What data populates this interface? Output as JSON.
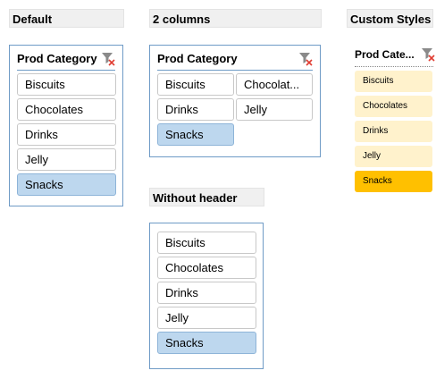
{
  "sections": {
    "default": "Default",
    "two_columns": "2 columns",
    "custom_styles": "Custom Styles",
    "without_header": "Without header"
  },
  "slicer_title": "Prod Category",
  "slicer_title_truncated": "Prod Cate...",
  "chocolates_truncated": "Chocolat...",
  "items": [
    "Biscuits",
    "Chocolates",
    "Drinks",
    "Jelly",
    "Snacks"
  ],
  "selected_item": "Snacks",
  "icons": {
    "clear_filter": "clear-filter-icon"
  },
  "colors": {
    "slicer_border": "#6f9bc6",
    "selected_fill": "#bdd7ee",
    "custom_item_fill": "#fff2cc",
    "custom_selected_fill": "#ffc000",
    "filter_icon_red": "#e03c31"
  }
}
